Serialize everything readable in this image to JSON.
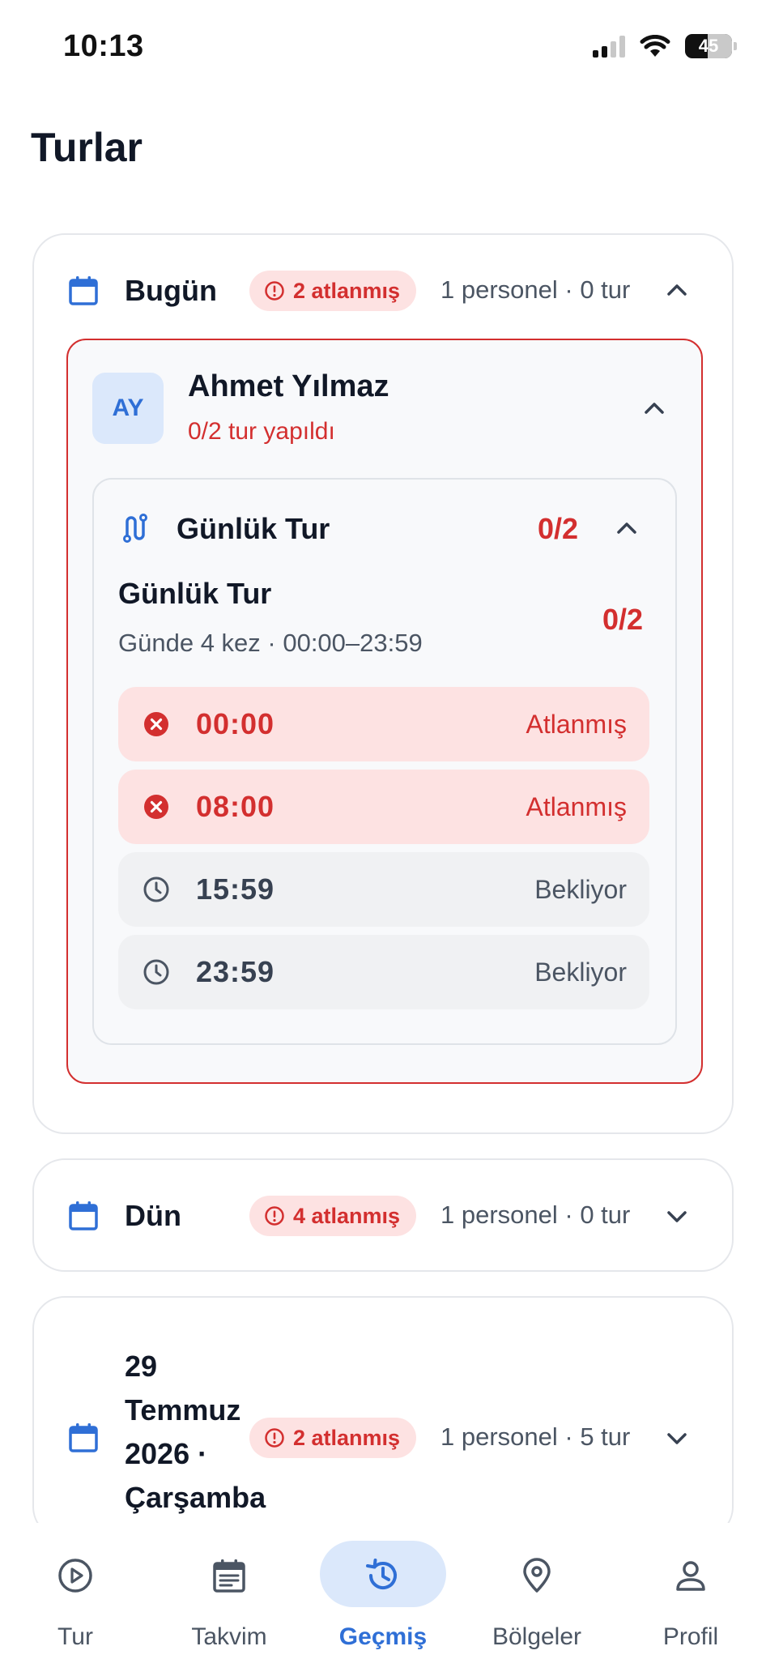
{
  "status_bar": {
    "time": "10:13",
    "battery": "45"
  },
  "page": {
    "title": "Turlar"
  },
  "days": {
    "today": {
      "label": "Bugün",
      "badge": "2 atlanmış",
      "meta": "1 personel · 0 tur",
      "expanded": true,
      "person": {
        "initials": "AY",
        "name": "Ahmet Yılmaz",
        "progress": "0/2 tur yapıldı",
        "tour": {
          "title": "Günlük Tur",
          "count": "0/2",
          "schedule": {
            "title": "Günlük Tur",
            "subtitle": "Günde 4 kez · 00:00–23:59",
            "count": "0/2"
          },
          "slots": [
            {
              "time": "00:00",
              "status": "Atlanmış",
              "state": "missed"
            },
            {
              "time": "08:00",
              "status": "Atlanmış",
              "state": "missed"
            },
            {
              "time": "15:59",
              "status": "Bekliyor",
              "state": "waiting"
            },
            {
              "time": "23:59",
              "status": "Bekliyor",
              "state": "waiting"
            }
          ]
        }
      }
    },
    "yesterday": {
      "label": "Dün",
      "badge": "4 atlanmış",
      "meta": "1 personel · 0 tur",
      "expanded": false
    },
    "older": {
      "label": "29 Temmuz 2026 · Çarşamba",
      "badge": "2 atlanmış",
      "meta": "1 personel · 5 tur",
      "expanded": false
    }
  },
  "nav": {
    "items": [
      {
        "label": "Tur",
        "icon": "play-circle-icon"
      },
      {
        "label": "Takvim",
        "icon": "calendar-list-icon"
      },
      {
        "label": "Geçmiş",
        "icon": "history-icon",
        "active": true
      },
      {
        "label": "Bölgeler",
        "icon": "location-pin-icon"
      },
      {
        "label": "Profil",
        "icon": "person-icon"
      }
    ]
  },
  "colors": {
    "accent": "#2f6fd6",
    "danger": "#d32f2f",
    "danger_bg": "#fde2e2",
    "active_pill": "#dbe8fb"
  }
}
